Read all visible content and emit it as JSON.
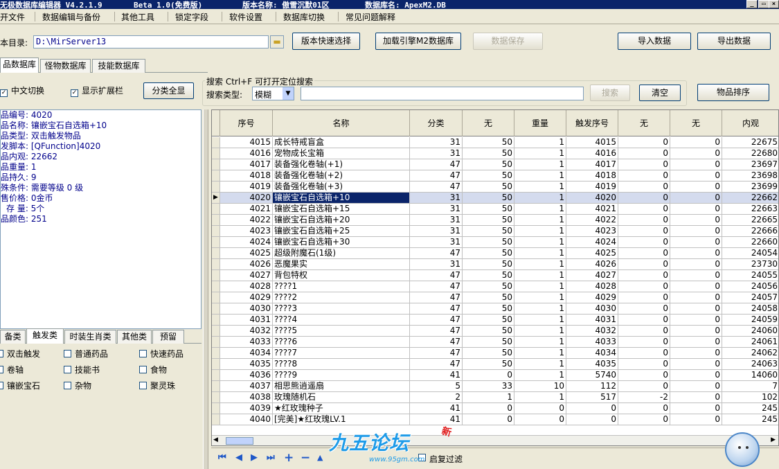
{
  "titlebar": {
    "app_title": "无极数据库编辑器 V4.2.1.9",
    "version_label": "Beta 1.0(免费版)",
    "version_name": "版本名称: 傲雪沉默01区",
    "db_name": "数据库名: ApexM2.DB",
    "minimize": "_",
    "close": "×"
  },
  "menu": [
    "开文件",
    "数据编辑与备份",
    "其他工具",
    "锁定字段",
    "软件设置",
    "数据库切换",
    "常见问题解释"
  ],
  "toolbar": {
    "dir_label": "本目录:",
    "dir_value": "D:\\MirServer13",
    "quick_select": "版本快速选择",
    "load_engine": "加载引擎M2数据库",
    "save_data": "数据保存",
    "import_data": "导入数据",
    "export_data": "导出数据"
  },
  "tabs": [
    "品数据库",
    "怪物数据库",
    "技能数据库"
  ],
  "options": {
    "chinese_switch": "中文切换",
    "show_expand": "显示扩展栏",
    "category_all": "分类全显"
  },
  "search": {
    "group_title": "搜索  Ctrl+F 可打开定位搜索",
    "type_label": "搜索类型:",
    "type_value": "模糊",
    "search_button": "搜索",
    "clear_button": "清空",
    "sort_button": "物品排序"
  },
  "info_lines": [
    "品编号: 4020",
    "品名称: 镶嵌宝石自选箱+10",
    "品类型: 双击触发物品",
    "发脚本: [QFunction]4020",
    "品内观: 22662",
    "品重量: 1",
    "品持久: 9",
    "殊条件: 需要等级 0 级",
    "售价格: 0金币",
    "存 量: 5个",
    "品颜色: 251"
  ],
  "category_tabs": [
    "备类",
    "触发类",
    "时装生肖类",
    "其他类",
    "预留"
  ],
  "category_checks": [
    [
      "双击触发",
      "普通药品",
      "快速药品"
    ],
    [
      "卷轴",
      "技能书",
      "食物"
    ],
    [
      "镶嵌宝石",
      "杂物",
      "聚灵珠"
    ]
  ],
  "grid": {
    "headers": [
      "序号",
      "名称",
      "分类",
      "无",
      "重量",
      "触发序号",
      "无",
      "无",
      "内观"
    ],
    "rows": [
      [
        "4015",
        "成长特戒盲盒",
        "31",
        "50",
        "1",
        "4015",
        "0",
        "0",
        "22675"
      ],
      [
        "4016",
        "宠物成长宝箱",
        "31",
        "50",
        "1",
        "4016",
        "0",
        "0",
        "22680"
      ],
      [
        "4017",
        "装备强化卷轴(+1)",
        "47",
        "50",
        "1",
        "4017",
        "0",
        "0",
        "23697"
      ],
      [
        "4018",
        "装备强化卷轴(+2)",
        "47",
        "50",
        "1",
        "4018",
        "0",
        "0",
        "23698"
      ],
      [
        "4019",
        "装备强化卷轴(+3)",
        "47",
        "50",
        "1",
        "4019",
        "0",
        "0",
        "23699"
      ],
      [
        "4020",
        "镶嵌宝石自选箱+10",
        "31",
        "50",
        "1",
        "4020",
        "0",
        "0",
        "22662"
      ],
      [
        "4021",
        "镶嵌宝石自选箱+15",
        "31",
        "50",
        "1",
        "4021",
        "0",
        "0",
        "22663"
      ],
      [
        "4022",
        "镶嵌宝石自选箱+20",
        "31",
        "50",
        "1",
        "4022",
        "0",
        "0",
        "22665"
      ],
      [
        "4023",
        "镶嵌宝石自选箱+25",
        "31",
        "50",
        "1",
        "4023",
        "0",
        "0",
        "22666"
      ],
      [
        "4024",
        "镶嵌宝石自选箱+30",
        "31",
        "50",
        "1",
        "4024",
        "0",
        "0",
        "22660"
      ],
      [
        "4025",
        "超级附魔石(1级)",
        "47",
        "50",
        "1",
        "4025",
        "0",
        "0",
        "24054"
      ],
      [
        "4026",
        "恶魔果实",
        "31",
        "50",
        "1",
        "4026",
        "0",
        "0",
        "23730"
      ],
      [
        "4027",
        "背包特权",
        "47",
        "50",
        "1",
        "4027",
        "0",
        "0",
        "24055"
      ],
      [
        "4028",
        "????1",
        "47",
        "50",
        "1",
        "4028",
        "0",
        "0",
        "24056"
      ],
      [
        "4029",
        "????2",
        "47",
        "50",
        "1",
        "4029",
        "0",
        "0",
        "24057"
      ],
      [
        "4030",
        "????3",
        "47",
        "50",
        "1",
        "4030",
        "0",
        "0",
        "24058"
      ],
      [
        "4031",
        "????4",
        "47",
        "50",
        "1",
        "4031",
        "0",
        "0",
        "24059"
      ],
      [
        "4032",
        "????5",
        "47",
        "50",
        "1",
        "4032",
        "0",
        "0",
        "24060"
      ],
      [
        "4033",
        "????6",
        "47",
        "50",
        "1",
        "4033",
        "0",
        "0",
        "24061"
      ],
      [
        "4034",
        "????7",
        "47",
        "50",
        "1",
        "4034",
        "0",
        "0",
        "24062"
      ],
      [
        "4035",
        "????8",
        "47",
        "50",
        "1",
        "4035",
        "0",
        "0",
        "24063"
      ],
      [
        "4036",
        "????9",
        "41",
        "0",
        "1",
        "5740",
        "0",
        "0",
        "14060"
      ],
      [
        "4037",
        "相思熊逍遥扇",
        "5",
        "33",
        "10",
        "112",
        "0",
        "0",
        "7"
      ],
      [
        "4038",
        "玫瑰随机石",
        "2",
        "1",
        "1",
        "517",
        "-2",
        "0",
        "102"
      ],
      [
        "4039",
        "★红玫瑰种子",
        "41",
        "0",
        "0",
        "0",
        "0",
        "0",
        "245"
      ],
      [
        "4040",
        "[完美]★红玫瑰LV.1",
        "41",
        "0",
        "0",
        "0",
        "0",
        "0",
        "245"
      ]
    ]
  },
  "nav": {
    "first": "⏮",
    "prior": "◀",
    "next": "▶",
    "last": "⏭",
    "insert": "+",
    "delete": "−",
    "edit": "▲",
    "filter_label": "启复过滤"
  },
  "watermark": {
    "logo": "九五论坛",
    "url": "www.95gm.com",
    "badge": "新"
  }
}
